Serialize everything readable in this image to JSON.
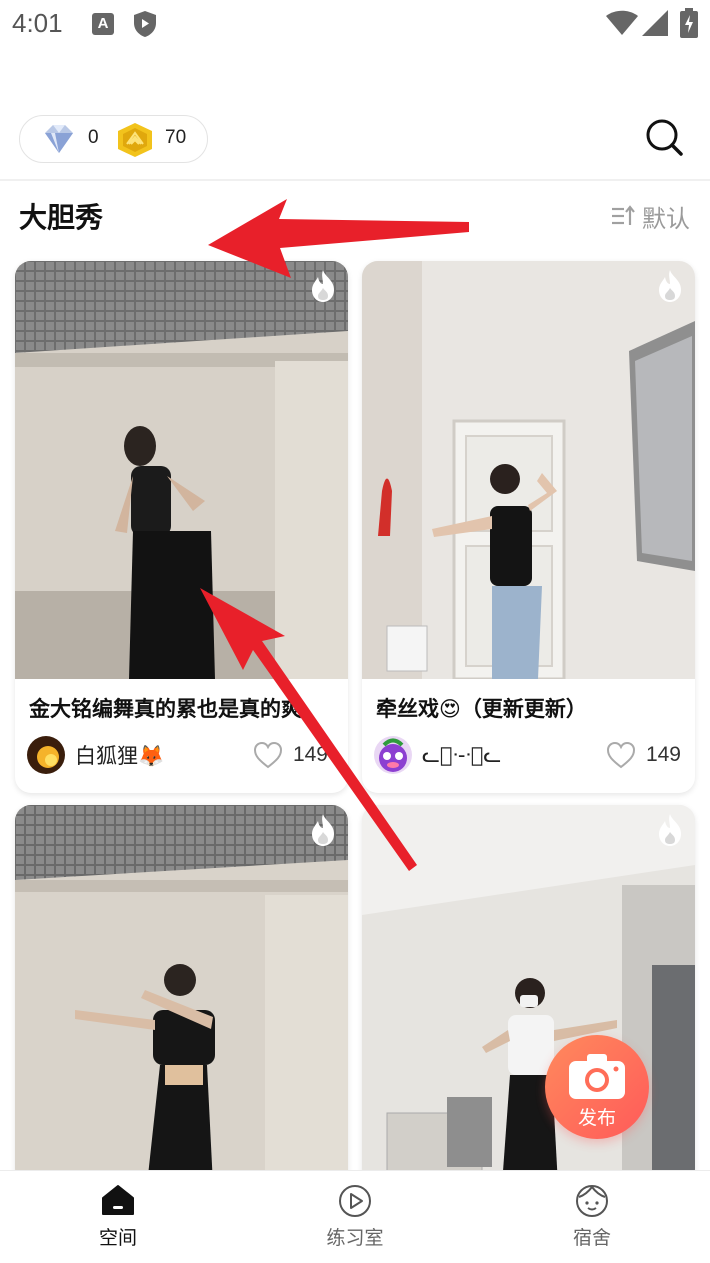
{
  "status_bar": {
    "time": "4:01",
    "a_badge": "A"
  },
  "header": {
    "diamond_count": "0",
    "coin_count": "70"
  },
  "section": {
    "title": "大胆秀",
    "sort_label": "默认"
  },
  "cards": [
    {
      "title": "金大铭编舞真的累也是真的爽",
      "author": "白狐狸🦊",
      "likes": "149"
    },
    {
      "title": "牵丝戏😍（更新更新）",
      "author": "ᓚ᷁ᐧ-ᐧ᷁ᓚ",
      "likes": "149"
    },
    {
      "title": "",
      "author": "",
      "likes": ""
    },
    {
      "title": "",
      "author": "",
      "likes": ""
    }
  ],
  "fab": {
    "label": "发布"
  },
  "bottom_nav": [
    {
      "label": "空间"
    },
    {
      "label": "练习室"
    },
    {
      "label": "宿舍"
    }
  ],
  "colors": {
    "accent": "#ff6a5a",
    "annotation_arrow": "#e8202a",
    "muted_text": "#9a9a9a"
  }
}
